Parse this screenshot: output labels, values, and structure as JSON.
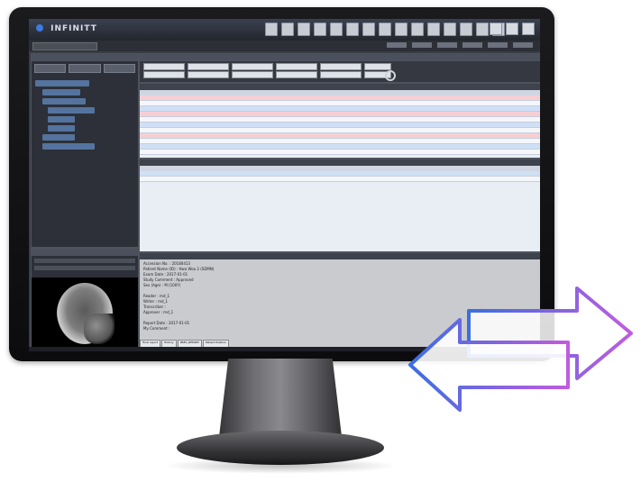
{
  "app": {
    "name": "INFINITT"
  },
  "report": {
    "lines": [
      "Accession No. : 20180413",
      "Patient Name (ID) : Hwa Woo 2 (SDMN)",
      "Exam Date : 2017-01-01",
      "Study Comment : Approved",
      "Sex (Age) : M (100Y)",
      "",
      "Reader : md_1",
      "Writer : md_1",
      "Transcriber :",
      "Approver : md_1",
      "",
      "Report Date : 2017-01-01",
      "My Comment :"
    ],
    "tabs": [
      "Final report",
      "History",
      "PREV_REPORT",
      "Patient Position"
    ]
  },
  "colors": {
    "accent": "#3c7be0",
    "arrow_gradient_start": "#3b6fe0",
    "arrow_gradient_end": "#c15be0"
  },
  "icons": {
    "logo": "infinitt-logo-icon",
    "search": "search-icon",
    "exchange": "exchange-arrows-icon"
  }
}
